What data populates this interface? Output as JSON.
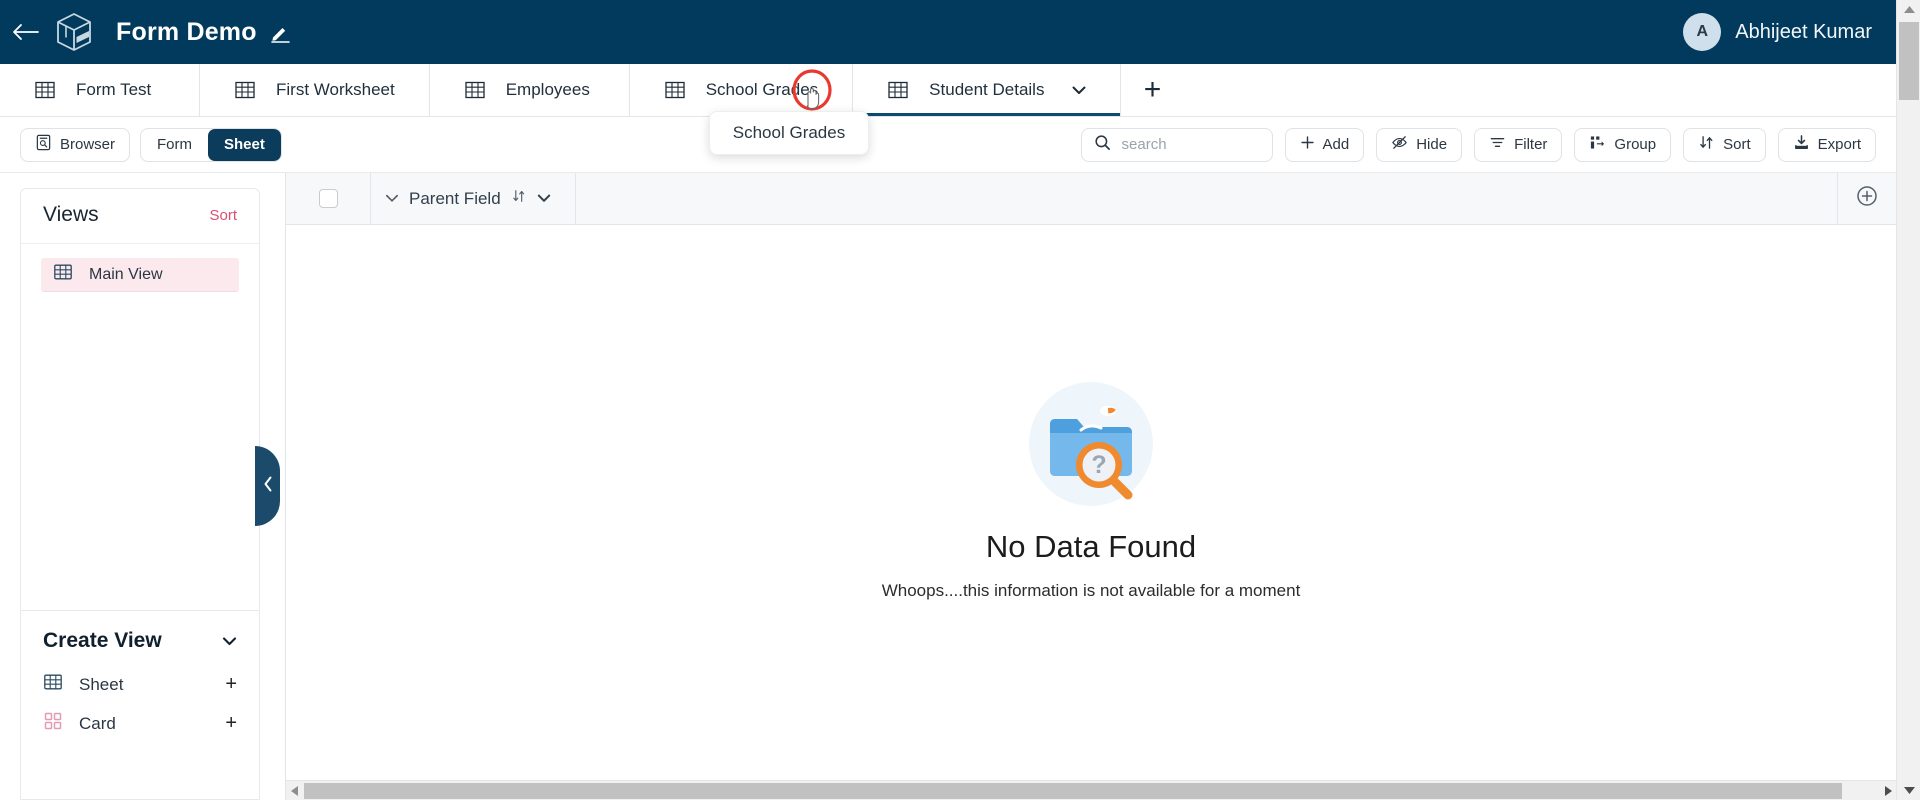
{
  "header": {
    "back_icon": "back-arrow-icon",
    "logo_icon": "cube-logo-icon",
    "title": "Form Demo",
    "edit_icon": "pencil-icon",
    "user": {
      "initial": "A",
      "name": "Abhijeet Kumar"
    },
    "background_color": "#013a5c"
  },
  "tabs": {
    "items": [
      {
        "label": "Form Test",
        "icon": "table-grid-icon",
        "active": false,
        "has_caret": false
      },
      {
        "label": "First Worksheet",
        "icon": "table-grid-icon",
        "active": false,
        "has_caret": false
      },
      {
        "label": "Employees",
        "icon": "table-grid-icon",
        "active": false,
        "has_caret": false
      },
      {
        "label": "School Grades",
        "icon": "table-grid-icon",
        "active": false,
        "has_caret": false
      },
      {
        "label": "Student Details",
        "icon": "table-grid-icon",
        "active": true,
        "has_caret": true
      }
    ],
    "add_label": "+",
    "tooltip": {
      "label": "School Grades",
      "visible": true
    }
  },
  "toolbar": {
    "browser_label": "Browser",
    "browser_icon": "browser-document-icon",
    "view_mode": {
      "options": [
        "Form",
        "Sheet"
      ],
      "selected": "Sheet"
    },
    "search": {
      "placeholder": "search",
      "value": ""
    },
    "search_icon": "search-icon",
    "buttons": [
      {
        "label": "Add",
        "icon": "plus-icon"
      },
      {
        "label": "Hide",
        "icon": "eye-off-icon"
      },
      {
        "label": "Filter",
        "icon": "filter-icon"
      },
      {
        "label": "Group",
        "icon": "group-icon"
      },
      {
        "label": "Sort",
        "icon": "sort-arrows-icon"
      },
      {
        "label": "Export",
        "icon": "download-icon"
      }
    ]
  },
  "sidebar": {
    "views": {
      "title": "Views",
      "sort_label": "Sort",
      "sort_color": "#d94f72",
      "items": [
        {
          "label": "Main View",
          "icon": "table-grid-icon",
          "selected": true
        }
      ]
    },
    "create_view": {
      "title": "Create View",
      "chevron_icon": "chevron-down-icon",
      "items": [
        {
          "label": "Sheet",
          "icon": "table-grid-icon",
          "action": "+",
          "icon_color": "#2b4a61"
        },
        {
          "label": "Card",
          "icon": "card-grid-icon",
          "action": "+",
          "icon_color": "#e39ab4"
        }
      ]
    },
    "collapse_handle_icon": "chevron-left-icon"
  },
  "grid": {
    "select_all_checkbox": false,
    "columns": [
      {
        "label": "Parent Field",
        "expand_icon": "chevron-down-icon",
        "sort_icon": "sort-arrows-icon",
        "menu_icon": "chevron-down-icon"
      }
    ],
    "add_column_icon": "plus-circle-icon",
    "rows": [],
    "empty_state": {
      "illustration": "folder-search-question-icon",
      "title": "No Data Found",
      "subtitle": "Whoops....this information is not available for a moment"
    }
  },
  "scrollbars": {
    "horizontal": {
      "left_arrow": "triangle-left-icon",
      "right_arrow": "triangle-right-icon"
    },
    "vertical": {
      "up_arrow": "triangle-up-icon",
      "down_arrow": "triangle-down-icon"
    }
  }
}
